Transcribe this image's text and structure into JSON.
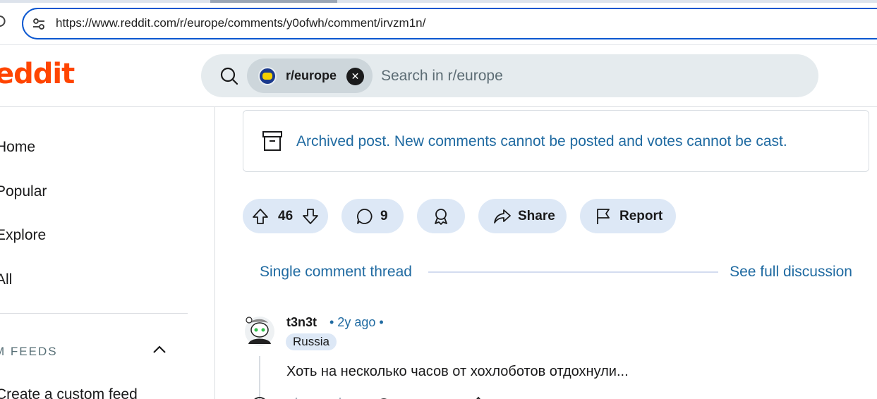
{
  "browser": {
    "url": "https://www.reddit.com/r/europe/comments/y0ofwh/comment/irvzm1n/"
  },
  "header": {
    "logo_text": "eddit",
    "search": {
      "chip_label": "r/europe",
      "placeholder": "Search in r/europe"
    }
  },
  "sidebar": {
    "items": [
      {
        "label": "Home"
      },
      {
        "label": "Popular"
      },
      {
        "label": "Explore"
      },
      {
        "label": "All"
      }
    ],
    "feeds_heading": "M FEEDS",
    "create_feed": "Create a custom feed"
  },
  "post": {
    "archived_notice": "Archived post. New comments cannot be posted and votes cannot be cast.",
    "votes": "46",
    "comments": "9",
    "share_label": "Share",
    "report_label": "Report"
  },
  "thread": {
    "single_label": "Single comment thread",
    "full_label": "See full discussion"
  },
  "comment": {
    "author": "t3n3t",
    "meta": "• 2y ago •",
    "flair": "Russia",
    "body": "Хоть на несколько часов от хохлоботов отдохнули..."
  },
  "colors": {
    "brand": "#ff4500",
    "link": "#1f6aa1",
    "button_bg": "#dde8f6"
  }
}
